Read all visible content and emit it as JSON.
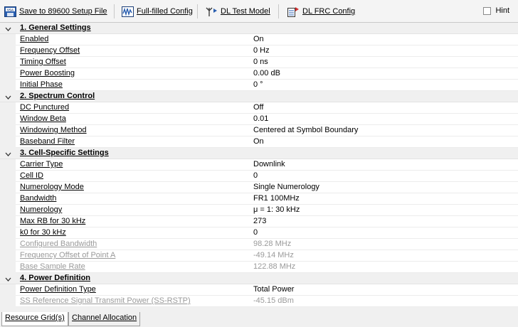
{
  "toolbar": {
    "save_label": "Save to 89600 Setup File",
    "fullfilled_label": "Full-filled Config",
    "dltest_label": "DL Test Model",
    "dlfrc_label": "DL FRC Config",
    "hint_label": "Hint",
    "hint_checked": false
  },
  "sections": [
    {
      "title": "1. General Settings",
      "rows": [
        {
          "name": "Enabled",
          "value": "On",
          "disabled": false
        },
        {
          "name": "Frequency Offset",
          "value": "0 Hz",
          "disabled": false
        },
        {
          "name": "Timing Offset",
          "value": "0 ns",
          "disabled": false
        },
        {
          "name": "Power Boosting",
          "value": "0.00 dB",
          "disabled": false
        },
        {
          "name": "Initial Phase",
          "value": "0 °",
          "disabled": false
        }
      ]
    },
    {
      "title": "2. Spectrum Control",
      "rows": [
        {
          "name": "DC Punctured",
          "value": "Off",
          "disabled": false
        },
        {
          "name": "Window Beta",
          "value": "0.01",
          "disabled": false
        },
        {
          "name": "Windowing Method",
          "value": "Centered at Symbol Boundary",
          "disabled": false
        },
        {
          "name": "Baseband Filter",
          "value": "On",
          "disabled": false
        }
      ]
    },
    {
      "title": "3. Cell-Specific Settings",
      "rows": [
        {
          "name": "Carrier Type",
          "value": "Downlink",
          "disabled": false
        },
        {
          "name": "Cell ID",
          "value": "0",
          "disabled": false
        },
        {
          "name": "Numerology Mode",
          "value": "Single Numerology",
          "disabled": false
        },
        {
          "name": "Bandwidth",
          "value": "FR1 100MHz",
          "disabled": false
        },
        {
          "name": "Numerology",
          "value": "μ = 1: 30 kHz",
          "disabled": false
        },
        {
          "name": "Max RB for 30 kHz",
          "value": "273",
          "disabled": false
        },
        {
          "name": "k0 for 30 kHz",
          "value": "0",
          "disabled": false
        },
        {
          "name": "Configured Bandwidth",
          "value": "98.28 MHz",
          "disabled": true
        },
        {
          "name": "Frequency Offset of Point A",
          "value": "-49.14 MHz",
          "disabled": true
        },
        {
          "name": "Base Sample Rate",
          "value": "122.88 MHz",
          "disabled": true
        }
      ]
    },
    {
      "title": "4. Power Definition",
      "rows": [
        {
          "name": "Power Definition Type",
          "value": "Total Power",
          "disabled": false
        },
        {
          "name": "SS Reference Signal Transmit Power (SS-RSTP)",
          "value": "-45.15 dBm",
          "disabled": true
        }
      ]
    }
  ],
  "tabs": [
    {
      "label": "Resource Grid(s)",
      "active": true
    },
    {
      "label": "Channel Allocation",
      "active": false
    }
  ],
  "icons": {
    "save": "save-icon",
    "fullfilled": "waveform-config-icon",
    "dltest": "antenna-icon",
    "dlfrc": "frc-config-icon",
    "chevron": "chevron-down-icon"
  }
}
